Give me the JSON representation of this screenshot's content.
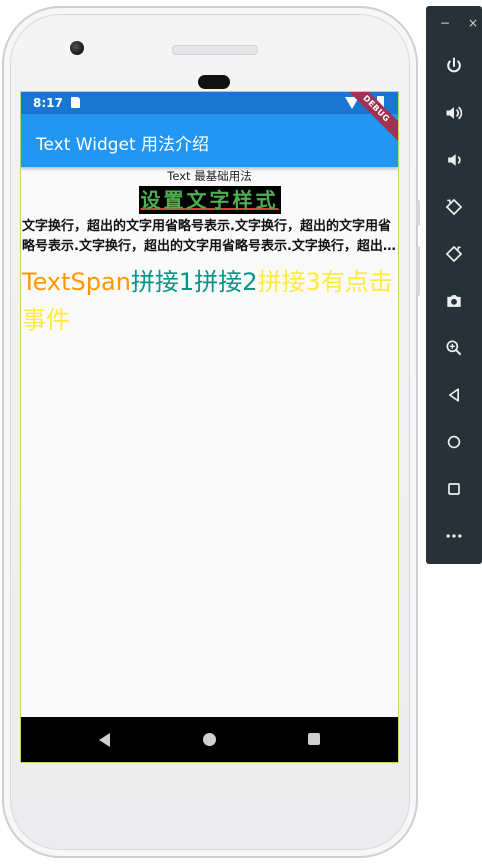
{
  "status_bar": {
    "time": "8:17"
  },
  "app_bar": {
    "title": "Text Widget 用法介绍"
  },
  "debug_banner": {
    "label": "DEBUG"
  },
  "content": {
    "basic_text": "Text 最基础用法",
    "styled_text": "设置文字样式",
    "wrap_text": "文字换行，超出的文字用省略号表示.文字换行，超出的文字用省略号表示.文字换行，超出的文字用省略号表示.文字换行，超出的文字用省略号表示.",
    "rich_text": {
      "span1": "TextSpan",
      "span2": "拼接1",
      "span3": "拼接2",
      "span4": "拼接3有点击事件"
    }
  },
  "emulator_toolbar": {
    "minimize_label": "−",
    "close_label": "×",
    "buttons": [
      "power-icon",
      "volume-up-icon",
      "volume-down-icon",
      "rotate-left-icon",
      "rotate-right-icon",
      "camera-icon",
      "zoom-icon",
      "back-icon",
      "home-icon",
      "overview-icon",
      "more-icon"
    ]
  },
  "colors": {
    "status_bar": "#1976d2",
    "app_bar": "#2196f3",
    "styled_text_fg": "#4caf50",
    "styled_text_bg": "#000000",
    "span_orange": "#ff9800",
    "span_teal": "#009688",
    "span_yellow": "#ffeb3b",
    "debug_ribbon": "#a0334f",
    "emulator_toolbar": "#263238"
  }
}
